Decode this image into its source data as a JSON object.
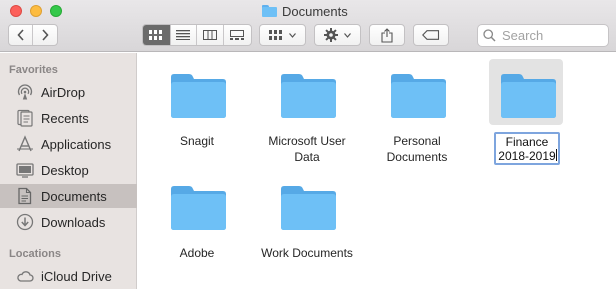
{
  "window": {
    "title": "Documents"
  },
  "toolbar": {
    "back": "back",
    "forward": "forward",
    "view_modes": [
      "icon-view",
      "list-view",
      "column-view",
      "gallery-view"
    ],
    "active_view": "icon-view",
    "group_menu": "group",
    "action_menu": "action",
    "share": "share",
    "tag": "tag"
  },
  "search": {
    "placeholder": "Search"
  },
  "sidebar": {
    "sections": [
      {
        "header": "Favorites",
        "items": [
          {
            "label": "AirDrop",
            "icon": "airdrop-icon"
          },
          {
            "label": "Recents",
            "icon": "recents-icon"
          },
          {
            "label": "Applications",
            "icon": "applications-icon"
          },
          {
            "label": "Desktop",
            "icon": "desktop-icon"
          },
          {
            "label": "Documents",
            "icon": "documents-icon",
            "selected": true
          },
          {
            "label": "Downloads",
            "icon": "downloads-icon"
          }
        ]
      },
      {
        "header": "Locations",
        "items": [
          {
            "label": "iCloud Drive",
            "icon": "icloud-icon"
          }
        ]
      }
    ]
  },
  "files": [
    {
      "name_lines": [
        "Snagit"
      ]
    },
    {
      "name_lines": [
        "Microsoft User",
        "Data"
      ]
    },
    {
      "name_lines": [
        "Personal",
        "Documents"
      ]
    },
    {
      "name_lines": [
        "Finance",
        "2018-2019"
      ],
      "renaming": true
    },
    {
      "name_lines": [
        "Adobe"
      ]
    },
    {
      "name_lines": [
        "Work Documents"
      ]
    }
  ],
  "colors": {
    "folder": "#6ec0f6",
    "sidebar_bg": "#e8e3e1",
    "selected_sidebar": "#c7c1bf",
    "rename_border": "#7ea5de"
  }
}
